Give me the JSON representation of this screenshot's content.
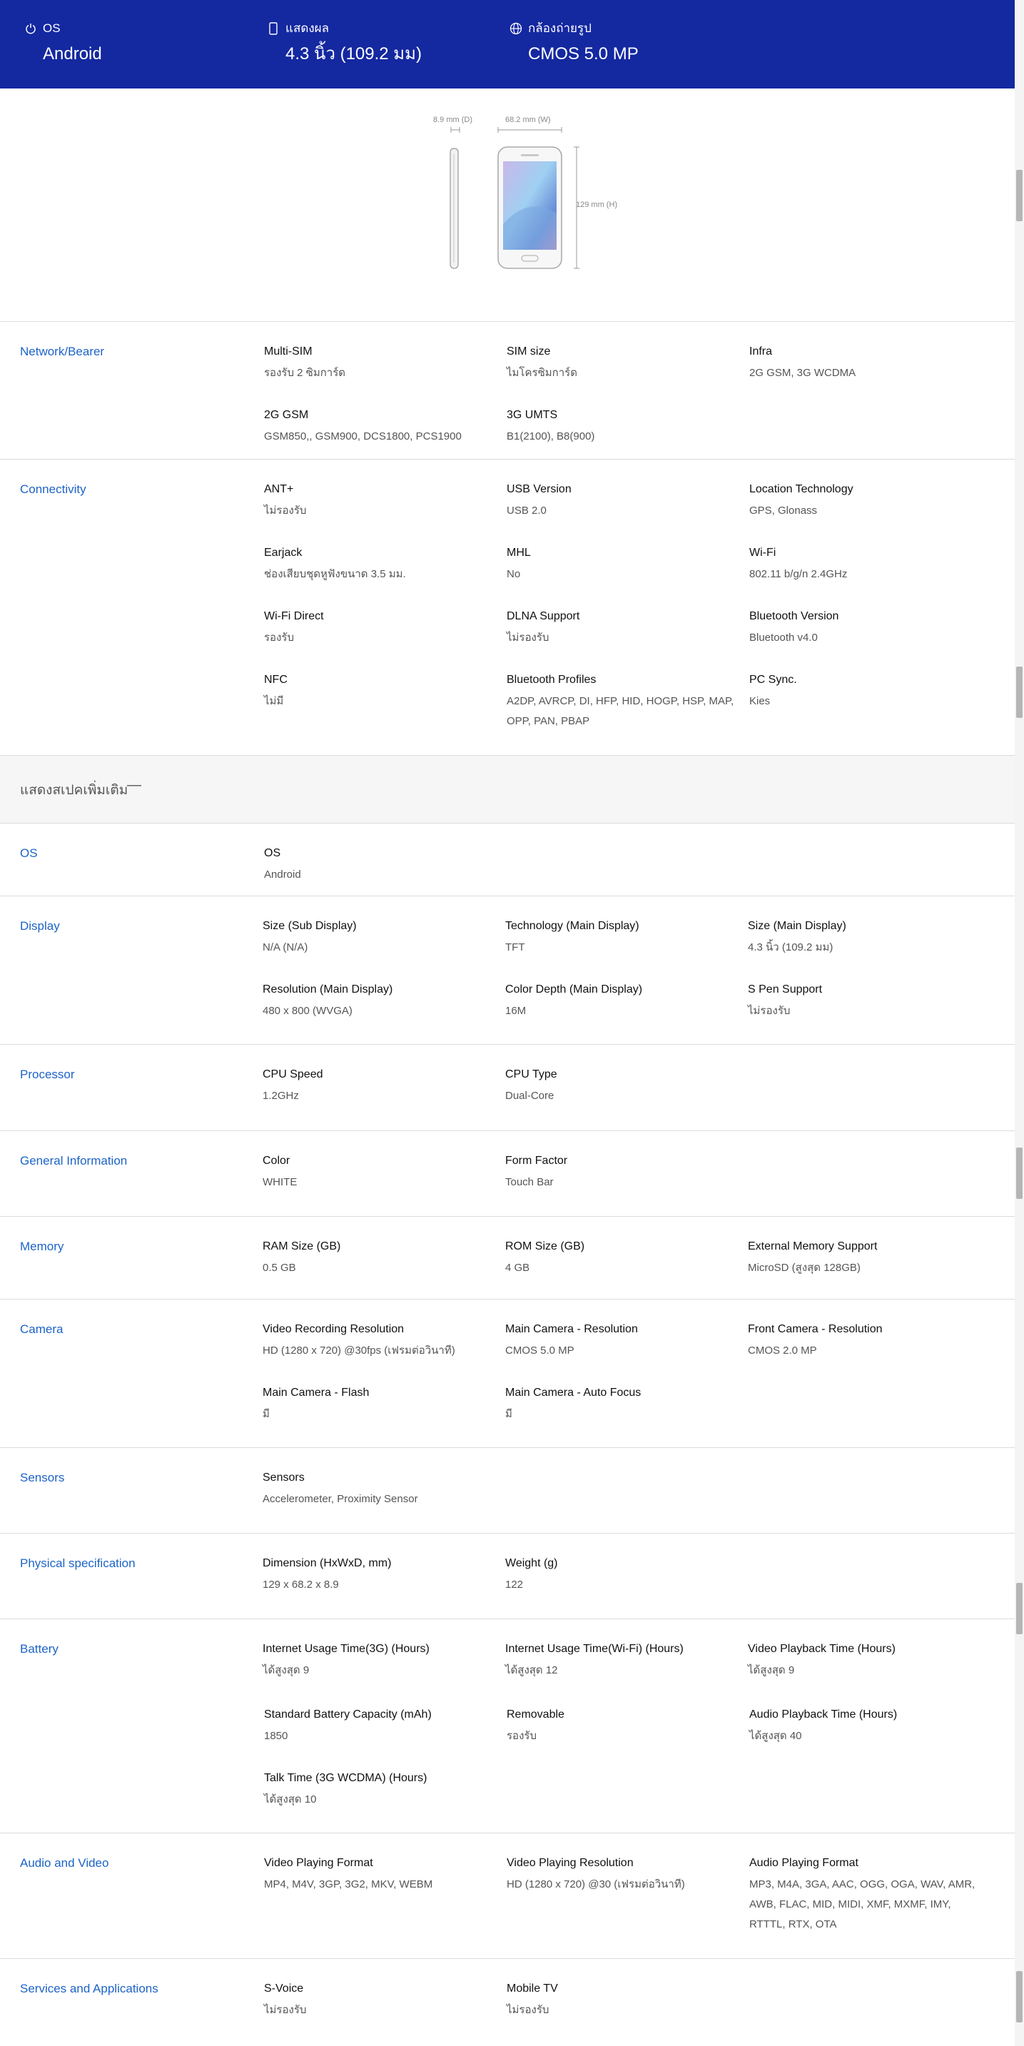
{
  "header": {
    "items": [
      {
        "icon": "power-icon",
        "label": "OS",
        "value": "Android"
      },
      {
        "icon": "display-icon",
        "label": "แสดงผล",
        "value": "4.3 นิ้ว (109.2 มม)"
      },
      {
        "icon": "globe-icon",
        "label": "กล้องถ่ายรูป",
        "value": "CMOS 5.0 MP"
      }
    ]
  },
  "figure": {
    "depth_label": "8.9 mm (D)",
    "width_label": "68.2 mm (W)",
    "height_label": "129 mm (H)"
  },
  "expander": {
    "label": "แสดงสเปคเพิ่มเติม",
    "icon": "minus-icon"
  },
  "sections": [
    {
      "title": "Network/Bearer",
      "cells": [
        {
          "k": "Multi-SIM",
          "v": "รองรับ 2 ซิมการ์ด"
        },
        {
          "k": "SIM size",
          "v": "ไมโครซิมการ์ด"
        },
        {
          "k": "Infra",
          "v": "2G GSM, 3G WCDMA"
        },
        {
          "k": "2G GSM",
          "v": "GSM850,, GSM900, DCS1800, PCS1900"
        },
        {
          "k": "3G UMTS",
          "v": "B1(2100), B8(900)"
        }
      ]
    },
    {
      "title": "Connectivity",
      "cells": [
        {
          "k": "ANT+",
          "v": "ไม่รองรับ"
        },
        {
          "k": "USB Version",
          "v": "USB 2.0"
        },
        {
          "k": "Location Technology",
          "v": "GPS, Glonass"
        },
        {
          "k": "Earjack",
          "v": "ช่องเสียบชุดหูฟังขนาด 3.5 มม."
        },
        {
          "k": "MHL",
          "v": "No"
        },
        {
          "k": "Wi-Fi",
          "v": "802.11 b/g/n 2.4GHz"
        },
        {
          "k": "Wi-Fi Direct",
          "v": "รองรับ"
        },
        {
          "k": "DLNA Support",
          "v": "ไม่รองรับ"
        },
        {
          "k": "Bluetooth Version",
          "v": "Bluetooth v4.0"
        },
        {
          "k": "NFC",
          "v": "ไม่มี"
        },
        {
          "k": "Bluetooth Profiles",
          "v": "A2DP, AVRCP, DI, HFP, HID, HOGP, HSP, MAP, OPP, PAN, PBAP"
        },
        {
          "k": "PC Sync.",
          "v": "Kies"
        }
      ]
    },
    {
      "title": "OS",
      "cells": [
        {
          "k": "OS",
          "v": "Android"
        }
      ]
    },
    {
      "title": "Display",
      "cells": [
        {
          "k": "Size (Sub Display)",
          "v": "N/A (N/A)"
        },
        {
          "k": "Technology (Main Display)",
          "v": "TFT"
        },
        {
          "k": "Size (Main Display)",
          "v": "4.3 นิ้ว (109.2 มม)"
        },
        {
          "k": "Resolution (Main Display)",
          "v": "480 x 800 (WVGA)"
        },
        {
          "k": "Color Depth (Main Display)",
          "v": "16M"
        },
        {
          "k": "S Pen Support",
          "v": "ไม่รองรับ"
        }
      ]
    },
    {
      "title": "Processor",
      "cells": [
        {
          "k": "CPU Speed",
          "v": "1.2GHz"
        },
        {
          "k": "CPU Type",
          "v": "Dual-Core"
        }
      ]
    },
    {
      "title": "General Information",
      "cells": [
        {
          "k": "Color",
          "v": "WHITE"
        },
        {
          "k": "Form Factor",
          "v": "Touch Bar"
        }
      ]
    },
    {
      "title": "Memory",
      "cells": [
        {
          "k": "RAM Size (GB)",
          "v": "0.5 GB"
        },
        {
          "k": "ROM Size (GB)",
          "v": "4 GB"
        },
        {
          "k": "External Memory Support",
          "v": "MicroSD (สูงสุด 128GB)"
        }
      ]
    },
    {
      "title": "Camera",
      "cells": [
        {
          "k": "Video Recording Resolution",
          "v": "HD (1280 x 720) @30fps (เฟรมต่อวินาที)"
        },
        {
          "k": "Main Camera - Resolution",
          "v": "CMOS 5.0 MP"
        },
        {
          "k": "Front Camera - Resolution",
          "v": "CMOS 2.0 MP"
        },
        {
          "k": "Main Camera - Flash",
          "v": "มี"
        },
        {
          "k": "Main Camera - Auto Focus",
          "v": "มี"
        }
      ]
    },
    {
      "title": "Sensors",
      "cells": [
        {
          "k": "Sensors",
          "v": "Accelerometer, Proximity Sensor"
        }
      ]
    },
    {
      "title": "Physical specification",
      "cells": [
        {
          "k": "Dimension (HxWxD, mm)",
          "v": "129 x 68.2 x 8.9"
        },
        {
          "k": "Weight (g)",
          "v": "122"
        }
      ]
    },
    {
      "title": "Battery",
      "cells": [
        {
          "k": "Internet Usage Time(3G) (Hours)",
          "v": "ได้สูงสุด 9"
        },
        {
          "k": "Internet Usage Time(Wi-Fi) (Hours)",
          "v": "ได้สูงสุด 12"
        },
        {
          "k": "Video Playback Time (Hours)",
          "v": "ได้สูงสุด 9"
        },
        {
          "k": "Standard Battery Capacity (mAh)",
          "v": "1850"
        },
        {
          "k": "Removable",
          "v": "รองรับ"
        },
        {
          "k": "Audio Playback Time (Hours)",
          "v": "ได้สูงสุด 40"
        },
        {
          "k": "Talk Time (3G WCDMA) (Hours)",
          "v": "ได้สูงสุด 10"
        }
      ]
    },
    {
      "title": "Audio and Video",
      "cells": [
        {
          "k": "Video Playing Format",
          "v": "MP4, M4V, 3GP, 3G2, MKV, WEBM"
        },
        {
          "k": "Video Playing Resolution",
          "v": "HD (1280 x 720) @30 (เฟรมต่อวินาที)"
        },
        {
          "k": "Audio Playing Format",
          "v": "MP3, M4A, 3GA, AAC, OGG, OGA, WAV, AMR, AWB, FLAC, MID, MIDI, XMF, MXMF, IMY, RTTTL, RTX, OTA"
        }
      ]
    },
    {
      "title": "Services and Applications",
      "cells": [
        {
          "k": "S-Voice",
          "v": "ไม่รองรับ"
        },
        {
          "k": "Mobile TV",
          "v": "ไม่รองรับ"
        }
      ]
    }
  ]
}
